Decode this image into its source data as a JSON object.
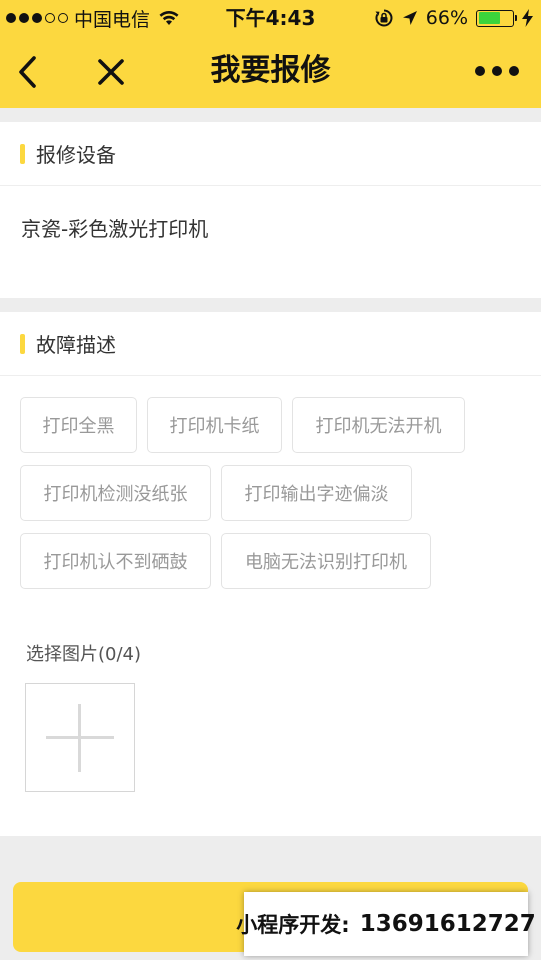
{
  "status_bar": {
    "carrier": "中国电信",
    "time": "下午4:43",
    "battery_percent": "66%",
    "battery_level": 0.66,
    "signal_dots_filled": 3,
    "signal_dots_total": 5,
    "icons": [
      "wifi-icon",
      "rotation-lock-icon",
      "location-arrow-icon",
      "battery-icon",
      "charging-bolt-icon"
    ]
  },
  "nav": {
    "title": "我要报修",
    "icons": [
      "back-chevron-icon",
      "close-x-icon",
      "more-dots-icon"
    ]
  },
  "device_section": {
    "title": "报修设备",
    "device_name": "京瓷-彩色激光打印机"
  },
  "fault_section": {
    "title": "故障描述",
    "tags": [
      "打印全黑",
      "打印机卡纸",
      "打印机无法开机",
      "打印机检测没纸张",
      "打印输出字迹偏淡",
      "打印机认不到硒鼓",
      "电脑无法识别打印机"
    ],
    "photo_label": "选择图片(0/4)",
    "add_photo_icon": "plus-icon"
  },
  "contact_banner": {
    "label": "小程序开发:",
    "phone": "13691612727"
  },
  "colors": {
    "accent": "#fcd83f",
    "background": "#ededed",
    "tag_border": "#e3e3e3",
    "tag_text": "#999999",
    "battery": "#3bd43b"
  }
}
